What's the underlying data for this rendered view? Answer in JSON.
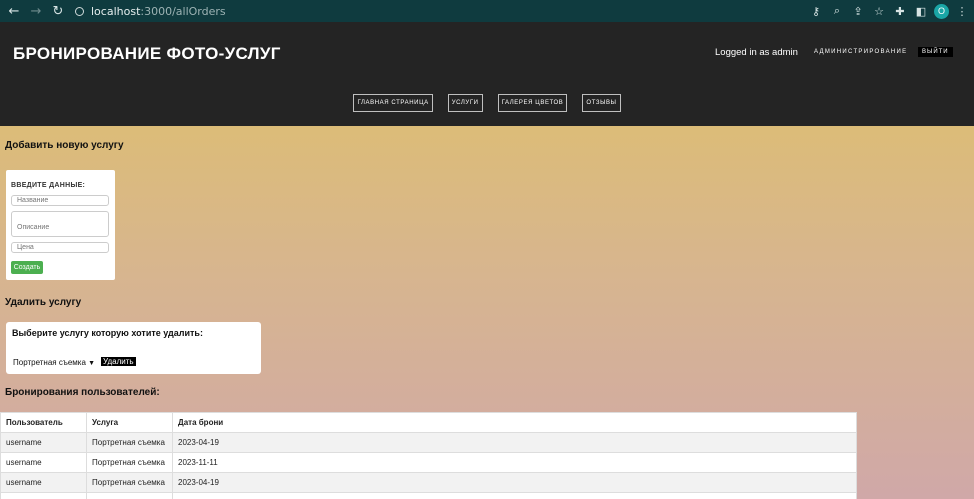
{
  "browser": {
    "url_host": "localhost",
    "url_path": ":3000/allOrders",
    "profile_initial": "O"
  },
  "header": {
    "site_title": "БРОНИРОВАНИЕ ФОТО-УСЛУГ",
    "logged_in_text": "Logged in as admin",
    "admin_link": "АДМИНИСТРИРОВАНИЕ",
    "logout_label": "ВЫЙТИ",
    "nav": [
      "ГЛАВНАЯ СТРАНИЦА",
      "УСЛУГИ",
      "ГАЛЕРЕЯ ЦВЕТОВ",
      "ОТЗЫВЫ"
    ]
  },
  "add_service": {
    "heading": "Добавить новую услугу",
    "form_title": "ВВЕДИТЕ ДАННЫЕ:",
    "name_placeholder": "Название",
    "description_placeholder": "Описание",
    "price_placeholder": "Цена",
    "create_label": "Создать"
  },
  "delete_service": {
    "heading": "Удалить услугу",
    "prompt": "Выберите услугу которую хотите удалить:",
    "selected_option": "Портретная съемка",
    "delete_label": "Удалить"
  },
  "bookings": {
    "heading": "Бронирования пользователей:",
    "columns": [
      "Пользователь",
      "Услуга",
      "Дата брони"
    ],
    "rows": [
      [
        "username",
        "Портретная съемка",
        "2023-04-19"
      ],
      [
        "username",
        "Портретная съемка",
        "2023-11-11"
      ],
      [
        "username",
        "Портретная съемка",
        "2023-04-19"
      ]
    ]
  }
}
